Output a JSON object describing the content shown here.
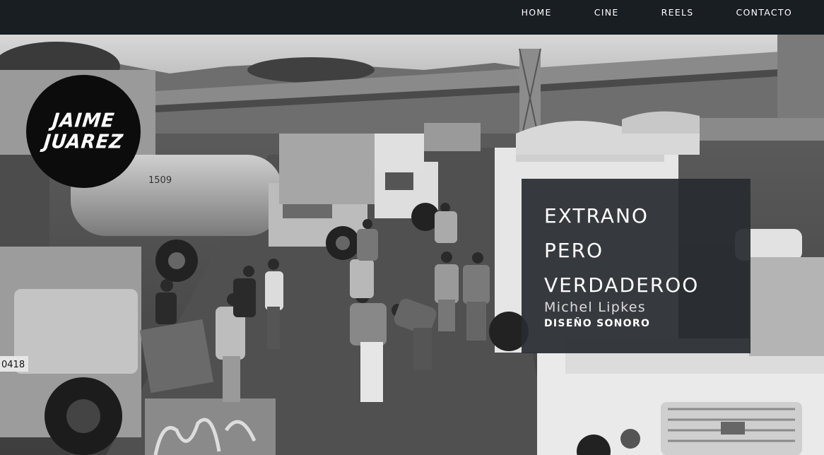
{
  "nav": {
    "items": [
      {
        "label": "HOME"
      },
      {
        "label": "CINE"
      },
      {
        "label": "REELS"
      },
      {
        "label": "CONTACTO"
      }
    ]
  },
  "logo": {
    "line1": "JAIME",
    "line2": "JUAREZ"
  },
  "feature": {
    "title_line1": "EXTRANO",
    "title_line2": "PERO",
    "title_line3": "VERDADEROO",
    "person": "Michel Lipkes",
    "role": "DISEÑO SONORO"
  },
  "hero_image": {
    "truck_number_1": "1509",
    "truck_number_2": "0418",
    "colors": {
      "topbar": "#191e22",
      "card": "#282c30"
    }
  }
}
